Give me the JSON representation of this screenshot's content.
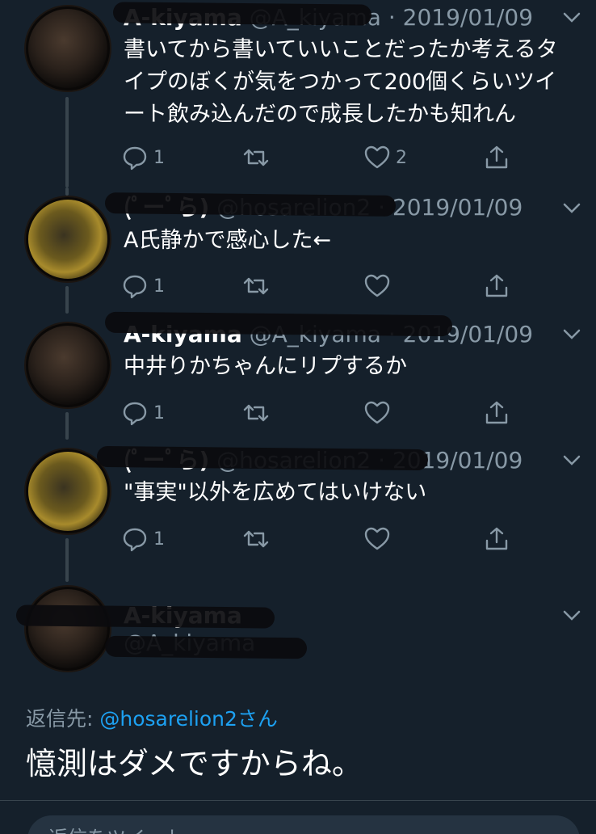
{
  "tweets": [
    {
      "name": "A-kiyama",
      "handle": "@A_kiyama",
      "sep": "·",
      "date": "2019/01/09",
      "text_lines": [
        "書いてから書いていいことだったか考えるタ",
        "イプのぼくが気をつかって200個くらいツイ",
        "ート飲み込んだので成長したかも知れん"
      ],
      "replies": "1",
      "likes": "2"
    },
    {
      "name": "(ﾟーﾟら)",
      "handle": "@hosarelion2",
      "sep": "·",
      "date": "2019/01/09",
      "text_lines": [
        "A氏静かで感心した←"
      ],
      "replies": "1",
      "likes": ""
    },
    {
      "name": "A-kiyama",
      "handle": "@A_kiyama",
      "sep": "·",
      "date": "2019/01/09",
      "text_lines": [
        "中井りかちゃんにリプするか"
      ],
      "replies": "1",
      "likes": ""
    },
    {
      "name": "(ﾟーﾟら)",
      "handle": "@hosarelion2",
      "sep": "·",
      "date": "2019/01/09",
      "text_lines": [
        "\"事実\"以外を広めてはいけない"
      ],
      "replies": "1",
      "likes": ""
    }
  ],
  "focused": {
    "name": "A-kiyama",
    "handle": "@A_kiyama",
    "reply_to_label": "返信先: ",
    "reply_to_mention": "@hosarelion2さん",
    "text": "憶測はダメですからね。"
  },
  "reply_box": {
    "placeholder": "返信をツイート"
  },
  "colors": {
    "background": "#15202b",
    "secondary_text": "#8899a6",
    "link": "#1da1f2",
    "thread_line": "#38444d"
  },
  "icons": [
    "reply-icon",
    "retweet-icon",
    "like-icon",
    "share-icon",
    "chevron-down-icon"
  ]
}
